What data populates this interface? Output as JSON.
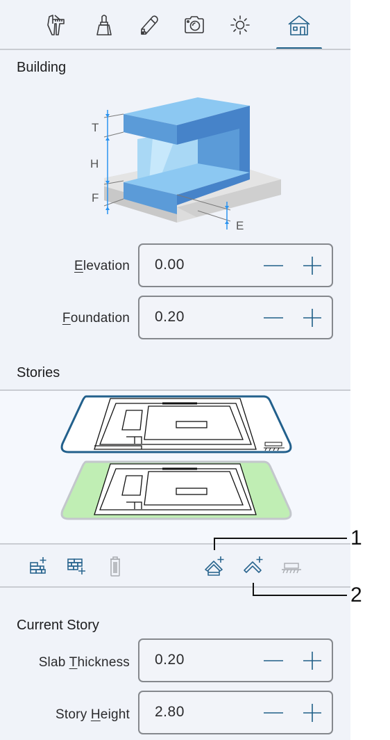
{
  "tabs": [
    {
      "id": "measure",
      "icon": "caliper-icon",
      "active": false
    },
    {
      "id": "materials",
      "icon": "brush-icon",
      "active": false
    },
    {
      "id": "edit",
      "icon": "pencil-icon",
      "active": false
    },
    {
      "id": "camera",
      "icon": "camera-icon",
      "active": false
    },
    {
      "id": "light",
      "icon": "sun-icon",
      "active": false
    },
    {
      "id": "building",
      "icon": "house-icon",
      "active": true
    }
  ],
  "building": {
    "title": "Building",
    "diagram_labels": {
      "t": "T",
      "h": "H",
      "f": "F",
      "e": "E"
    },
    "fields": [
      {
        "label_mnemonic": "E",
        "label_rest": "levation",
        "value": "0.00"
      },
      {
        "label_mnemonic": "F",
        "label_rest": "oundation",
        "value": "0.20"
      }
    ]
  },
  "stories": {
    "title": "Stories",
    "items": [
      {
        "name": "upper-story",
        "selected": true,
        "current": false
      },
      {
        "name": "ground-story",
        "selected": false,
        "current": true
      }
    ]
  },
  "toolbar": {
    "left": [
      {
        "name": "add-story-above-button",
        "icon": "brick-add-above-icon",
        "enabled": true
      },
      {
        "name": "add-story-below-button",
        "icon": "brick-add-below-icon",
        "enabled": true
      },
      {
        "name": "delete-story-button",
        "icon": "trash-icon",
        "enabled": false
      }
    ],
    "right": [
      {
        "name": "add-roof-button",
        "icon": "house-roof-add-icon",
        "enabled": true
      },
      {
        "name": "add-roof-only-button",
        "icon": "roof-add-icon",
        "enabled": true
      },
      {
        "name": "foundation-button",
        "icon": "ground-slab-icon",
        "enabled": false
      }
    ]
  },
  "current_story": {
    "title": "Current Story",
    "fields": [
      {
        "label_pre": "Slab ",
        "label_mnemonic": "T",
        "label_rest": "hickness",
        "value": "0.20"
      },
      {
        "label_pre": "Story ",
        "label_mnemonic": "H",
        "label_rest": "eight",
        "value": "2.80"
      }
    ]
  },
  "callouts": [
    "1",
    "2"
  ],
  "colors": {
    "accent": "#1f5f87",
    "icon_gray": "#3a3a3c",
    "disabled": "#a8abb0",
    "story_selected_border": "#22608c",
    "story_current_fill": "#c0eeb4",
    "panel_bg": "#f0f3f9"
  }
}
